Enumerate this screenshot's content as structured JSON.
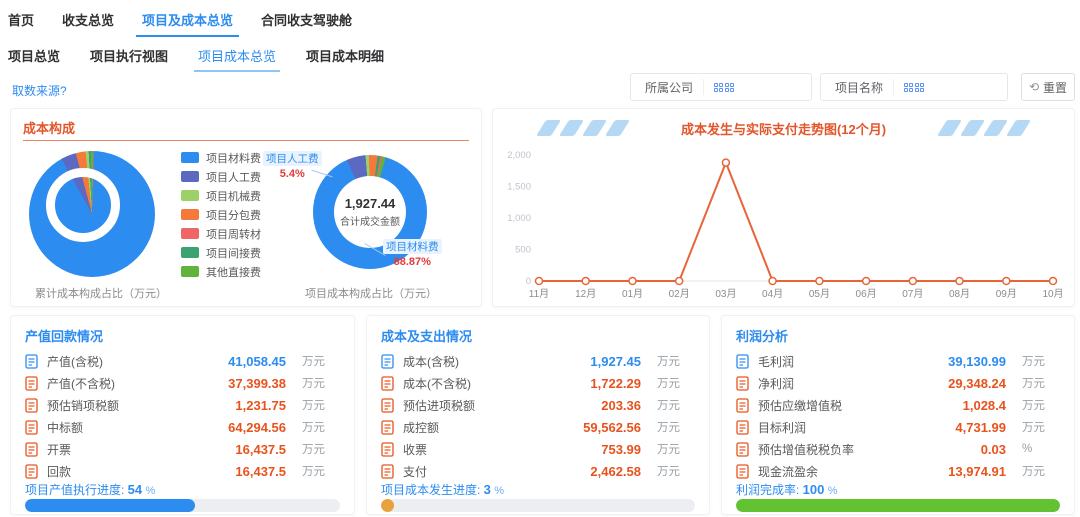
{
  "colors": {
    "accent_blue": "#2d8cf0",
    "title_orange": "#e2562b",
    "value_blue": "#2d8cf0",
    "value_orange": "#e8531d",
    "pct_red": "#e23b3b",
    "line_orange": "#e8653a",
    "progress_blue": "#2d8cf0",
    "progress_amber": "#e9a23b",
    "progress_green": "#62c232"
  },
  "nav": {
    "tabs": [
      {
        "label": "首页",
        "active": false
      },
      {
        "label": "收支总览",
        "active": false
      },
      {
        "label": "项目及成本总览",
        "active": true
      },
      {
        "label": "合同收支驾驶舱",
        "active": false
      }
    ]
  },
  "subnav": {
    "tabs": [
      {
        "label": "项目总览",
        "active": false
      },
      {
        "label": "项目执行视图",
        "active": false
      },
      {
        "label": "项目成本总览",
        "active": true
      },
      {
        "label": "项目成本明细",
        "active": false
      }
    ]
  },
  "source_link": "取数来源?",
  "filters": {
    "company": {
      "label": "所属公司",
      "value": ""
    },
    "project": {
      "label": "项目名称",
      "value": ""
    },
    "reset_label": "重置"
  },
  "cost_composition": {
    "title": "成本构成",
    "legend": [
      {
        "label": "项目材料费",
        "color": "#2d8cf0"
      },
      {
        "label": "项目人工费",
        "color": "#5b6ac0"
      },
      {
        "label": "项目机械费",
        "color": "#9ed06a"
      },
      {
        "label": "项目分包费",
        "color": "#f5793b"
      },
      {
        "label": "项目周转材",
        "color": "#ee6666"
      },
      {
        "label": "项目间接费",
        "color": "#3ba272"
      },
      {
        "label": "其他直接费",
        "color": "#61b33b"
      }
    ],
    "left_caption": "累计成本构成占比（万元）",
    "right_caption": "项目成本构成占比（万元）",
    "center_value": "1,927.44",
    "center_label": "合计成交金额",
    "callouts": [
      {
        "label": "项目人工费",
        "value": "5.4%"
      },
      {
        "label": "项目材料费",
        "value": "88.87%"
      }
    ]
  },
  "chart_data": [
    {
      "type": "pie",
      "title": "累计成本构成占比（万元）",
      "start_angle_deg": 331,
      "slices": [
        {
          "name": "项目人工费",
          "color": "#5b6ac0",
          "pct": 3.9
        },
        {
          "name": "项目分包费",
          "color": "#f5793b",
          "pct": 2.5
        },
        {
          "name": "项目机械费",
          "color": "#9ed06a",
          "pct": 0.8
        },
        {
          "name": "项目间接费",
          "color": "#3ba272",
          "pct": 0.6
        },
        {
          "name": "其他直接费",
          "color": "#61b33b",
          "pct": 0.5
        },
        {
          "name": "项目周转材",
          "color": "#ee6666",
          "pct": 0.2
        },
        {
          "name": "项目材料费",
          "color": "#2d8cf0",
          "pct": 91.5
        }
      ]
    },
    {
      "type": "pie",
      "title": "项目成本构成占比（万元）",
      "center_value": "1,927.44",
      "center_label": "合计成交金额",
      "start_angle_deg": 336,
      "slices": [
        {
          "name": "项目人工费",
          "color": "#5b6ac0",
          "pct": 5.4
        },
        {
          "name": "项目机械费",
          "color": "#9ed06a",
          "pct": 1.0
        },
        {
          "name": "项目分包费",
          "color": "#f5793b",
          "pct": 2.4
        },
        {
          "name": "项目间接费",
          "color": "#3ba272",
          "pct": 0.8
        },
        {
          "name": "项目周转材",
          "color": "#ee6666",
          "pct": 0.5
        },
        {
          "name": "其他直接费",
          "color": "#61b33b",
          "pct": 1.03
        },
        {
          "name": "项目材料费",
          "color": "#2d8cf0",
          "pct": 88.87
        }
      ]
    },
    {
      "type": "line",
      "title": "成本发生与实际支付走势图(12个月)",
      "x": [
        "11月",
        "12月",
        "01月",
        "02月",
        "03月",
        "04月",
        "05月",
        "06月",
        "07月",
        "08月",
        "09月",
        "10月"
      ],
      "values": [
        0,
        0,
        0,
        0,
        1880,
        0,
        0,
        0,
        0,
        0,
        0,
        0
      ],
      "ylim": [
        0,
        2000
      ],
      "y_ticks": [
        0,
        500,
        1000,
        1500,
        2000
      ],
      "y_tick_labels": [
        "0",
        "500",
        "1,000",
        "1,500",
        "2,000"
      ],
      "grid": false,
      "line_color": "#e8653a"
    }
  ],
  "trend": {
    "title": "成本发生与实际支付走势图(12个月)"
  },
  "panels": [
    {
      "title": "产值回款情况",
      "rows": [
        {
          "label": "产值(含税)",
          "value": "41,058.45",
          "unit": "万元",
          "highlight": "blue"
        },
        {
          "label": "产值(不含税)",
          "value": "37,399.38",
          "unit": "万元",
          "highlight": "orange"
        },
        {
          "label": "预估销项税额",
          "value": "1,231.75",
          "unit": "万元",
          "highlight": "orange"
        },
        {
          "label": "中标额",
          "value": "64,294.56",
          "unit": "万元",
          "highlight": "orange"
        },
        {
          "label": "开票",
          "value": "16,437.5",
          "unit": "万元",
          "highlight": "orange"
        },
        {
          "label": "回款",
          "value": "16,437.5",
          "unit": "万元",
          "highlight": "orange"
        }
      ],
      "progress": {
        "label": "项目产值执行进度:",
        "display": "54",
        "unit": "%",
        "pct": 54,
        "color": "#2d8cf0"
      }
    },
    {
      "title": "成本及支出情况",
      "rows": [
        {
          "label": "成本(含税)",
          "value": "1,927.45",
          "unit": "万元",
          "highlight": "blue"
        },
        {
          "label": "成本(不含税)",
          "value": "1,722.29",
          "unit": "万元",
          "highlight": "orange"
        },
        {
          "label": "预估进项税额",
          "value": "203.36",
          "unit": "万元",
          "highlight": "orange"
        },
        {
          "label": "成控额",
          "value": "59,562.56",
          "unit": "万元",
          "highlight": "orange"
        },
        {
          "label": "收票",
          "value": "753.99",
          "unit": "万元",
          "highlight": "orange"
        },
        {
          "label": "支付",
          "value": "2,462.58",
          "unit": "万元",
          "highlight": "orange"
        }
      ],
      "progress": {
        "label": "项目成本发生进度:",
        "display": "3",
        "unit": "%",
        "pct": 3,
        "color": "#e9a23b"
      }
    },
    {
      "title": "利润分析",
      "rows": [
        {
          "label": "毛利润",
          "value": "39,130.99",
          "unit": "万元",
          "highlight": "blue"
        },
        {
          "label": "净利润",
          "value": "29,348.24",
          "unit": "万元",
          "highlight": "orange"
        },
        {
          "label": "预估应缴增值税",
          "value": "1,028.4",
          "unit": "万元",
          "highlight": "orange"
        },
        {
          "label": "目标利润",
          "value": "4,731.99",
          "unit": "万元",
          "highlight": "orange"
        },
        {
          "label": "预估增值税税负率",
          "value": "0.03",
          "unit": "%",
          "highlight": "orange"
        },
        {
          "label": "现金流盈余",
          "value": "13,974.91",
          "unit": "万元",
          "highlight": "orange"
        }
      ],
      "progress": {
        "label": "利润完成率:",
        "display": "100",
        "unit": "%",
        "pct": 100,
        "color": "#62c232"
      }
    }
  ]
}
